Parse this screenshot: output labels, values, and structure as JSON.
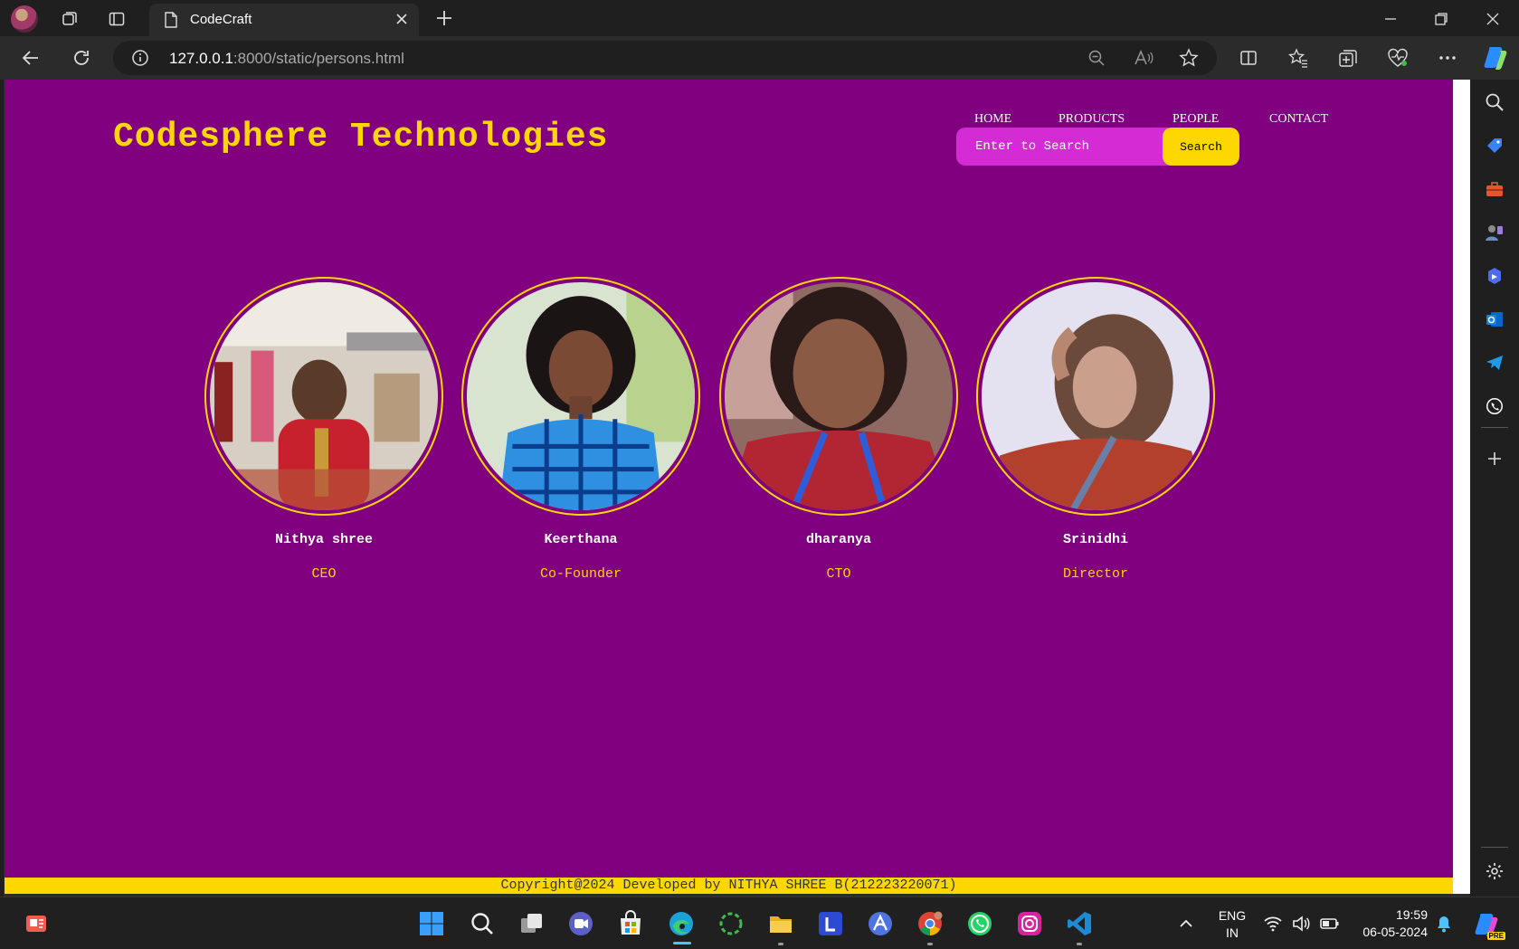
{
  "browser": {
    "tab_title": "CodeCraft",
    "address_host": "127.0.0.1",
    "address_path": ":8000/static/persons.html"
  },
  "site": {
    "brand": "Codesphere Technologies",
    "nav": [
      "HOME",
      "PRODUCTS",
      "PEOPLE",
      "CONTACT"
    ],
    "search_placeholder": "Enter to Search",
    "search_button": "Search",
    "people": [
      {
        "name": "Nithya shree",
        "role": "CEO"
      },
      {
        "name": "Keerthana",
        "role": "Co-Founder"
      },
      {
        "name": "dharanya",
        "role": "CTO"
      },
      {
        "name": "Srinidhi",
        "role": "Director"
      }
    ],
    "footer": "Copyright@2024 Developed by NITHYA SHREE B(212223220071)"
  },
  "colors": {
    "page_bg": "#800080",
    "accent": "#ffd700",
    "search_bg": "#d42bd4"
  },
  "taskbar": {
    "lang_line1": "ENG",
    "lang_line2": "IN",
    "time": "19:59",
    "date": "06-05-2024",
    "copilot_badge": "PRE"
  }
}
